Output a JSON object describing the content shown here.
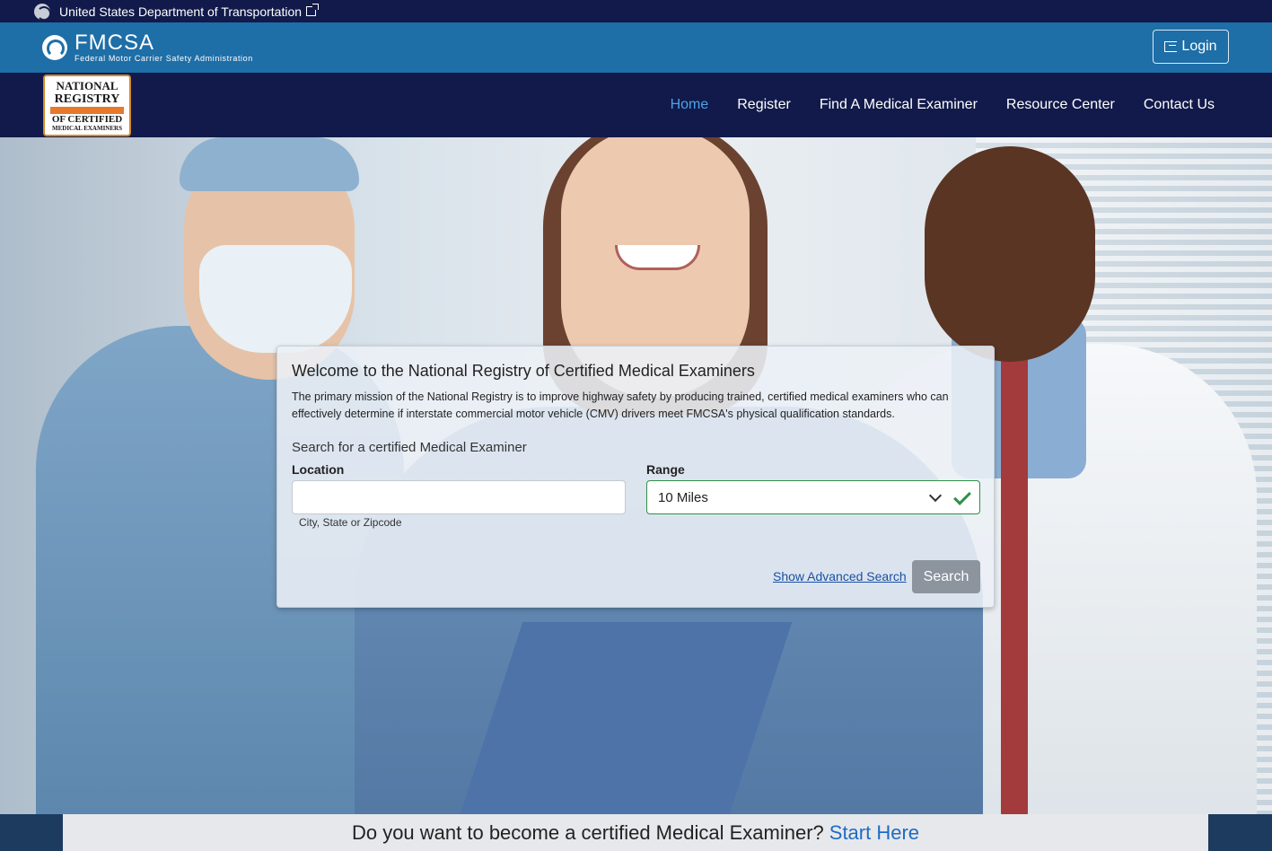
{
  "dot_bar": {
    "label": "United States Department of Transportation"
  },
  "fmcsa": {
    "name": "FMCSA",
    "subtitle": "Federal Motor Carrier Safety Administration",
    "login_label": "Login"
  },
  "registry_logo": {
    "line1": "NATIONAL",
    "line2": "REGISTRY",
    "line3": "OF CERTIFIED",
    "line4": "MEDICAL EXAMINERS"
  },
  "nav": {
    "items": [
      {
        "label": "Home",
        "active": true
      },
      {
        "label": "Register"
      },
      {
        "label": "Find A Medical Examiner"
      },
      {
        "label": "Resource Center"
      },
      {
        "label": "Contact Us"
      }
    ]
  },
  "welcome": {
    "title": "Welcome to the National Registry of Certified Medical Examiners",
    "description": "The primary mission of the National Registry is to improve highway safety by producing trained, certified medical examiners who can effectively determine if interstate commercial motor vehicle (CMV) drivers meet FMCSA's physical qualification standards.",
    "search_heading": "Search for a certified Medical Examiner",
    "location_label": "Location",
    "location_value": "",
    "location_hint": "City, State or Zipcode",
    "range_label": "Range",
    "range_value": "10 Miles",
    "advanced_link": "Show Advanced Search",
    "search_button": "Search"
  },
  "cta": {
    "text": "Do you want to become a certified Medical Examiner?",
    "link": "Start Here"
  },
  "colors": {
    "nav_bg": "#111a4a",
    "fmcsa_bg": "#1e6ea7",
    "active_link": "#4da3e8",
    "valid_green": "#2f8f46"
  }
}
